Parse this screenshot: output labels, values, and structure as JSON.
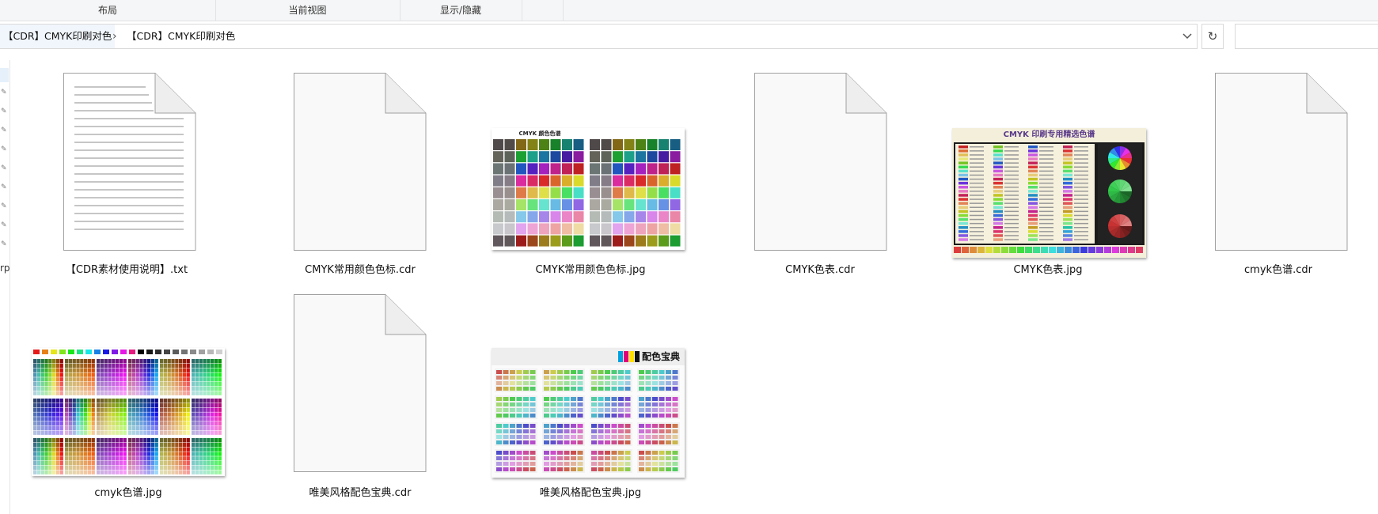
{
  "ribbon": {
    "groups": [
      "布局",
      "当前视图",
      "显示/隐藏"
    ]
  },
  "address_bar": {
    "crumbs": [
      "【CDR】CMYK印刷对色",
      "【CDR】CMYK印刷对色"
    ],
    "separator": "›",
    "dropdown_icon": "chevron-down-icon",
    "refresh_icon": "refresh-icon",
    "search_placeholder": ""
  },
  "nav_pane": {
    "fragment_text": "rp"
  },
  "files": [
    {
      "name": "【CDR素材使用说明】.txt",
      "kind": "text-document"
    },
    {
      "name": "CMYK常用颜色色标.cdr",
      "kind": "blank-document"
    },
    {
      "name": "CMYK常用颜色色标.jpg",
      "kind": "image",
      "thumb_title": "CMYK 颜色色谱"
    },
    {
      "name": "CMYK色表.cdr",
      "kind": "blank-document"
    },
    {
      "name": "CMYK色表.jpg",
      "kind": "image",
      "thumb_title": "CMYK 印刷专用精选色谱"
    },
    {
      "name": "cmyk色谱.cdr",
      "kind": "blank-document"
    },
    {
      "name": "cmyk色谱.jpg",
      "kind": "image"
    },
    {
      "name": "唯美风格配色宝典.cdr",
      "kind": "blank-document"
    },
    {
      "name": "唯美风格配色宝典.jpg",
      "kind": "image",
      "thumb_title": "配色宝典"
    }
  ],
  "colors": {
    "accent_selection": "#e5f0fa",
    "ribbon_bg": "#f5f6f7",
    "doc_border": "#a0a0a0"
  }
}
